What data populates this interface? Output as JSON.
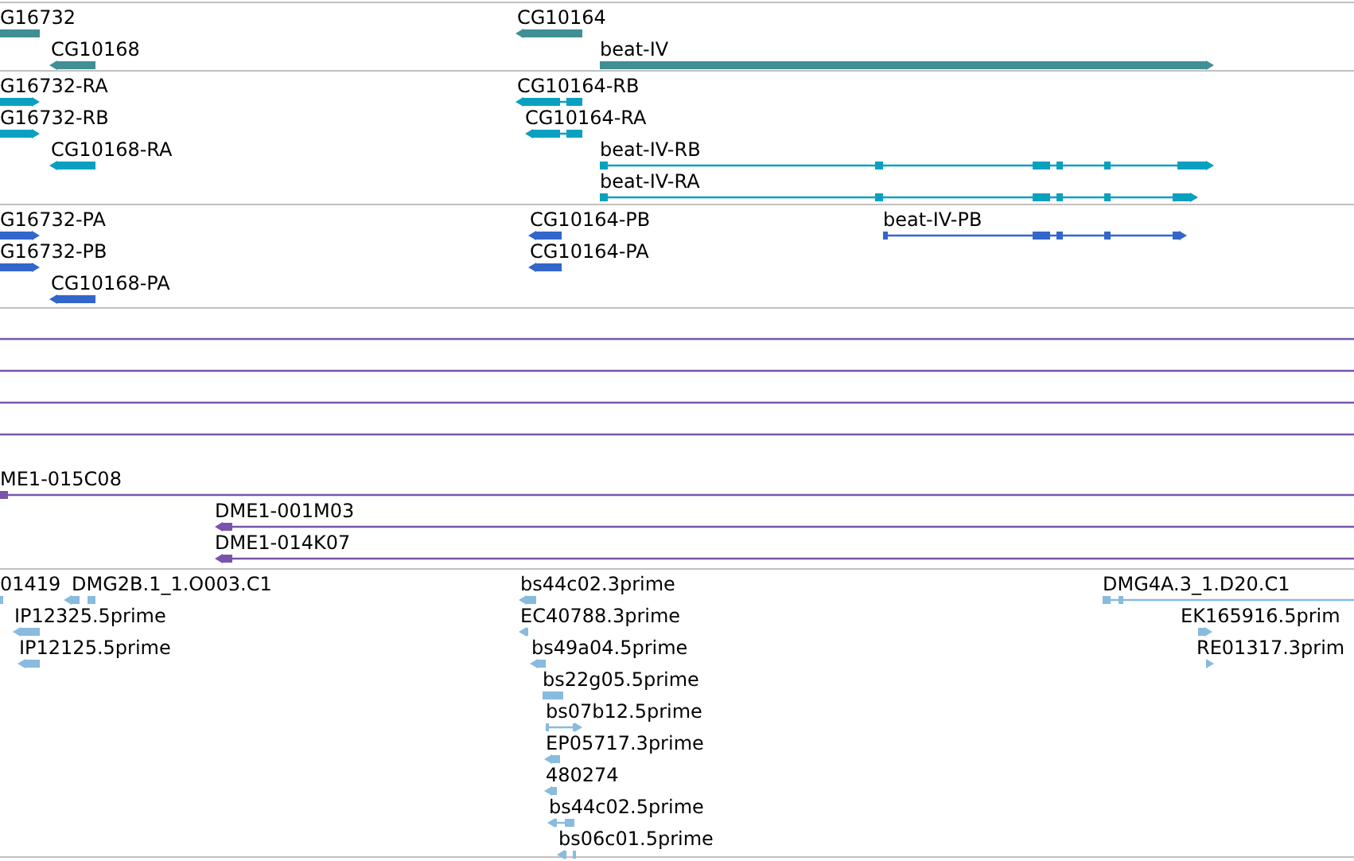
{
  "tracks": [
    {
      "color": "#3f8f94",
      "features": [
        {
          "label": "G16732",
          "kind": "block"
        },
        {
          "label": "CG10164",
          "kind": "block"
        },
        {
          "label": "CG10168",
          "kind": "block"
        },
        {
          "label": "beat-IV",
          "kind": "block"
        }
      ]
    },
    {
      "color": "#0aa0c0",
      "features": [
        {
          "label": "G16732-RA",
          "kind": "block"
        },
        {
          "label": "CG10164-RB",
          "kind": "spliced"
        },
        {
          "label": "G16732-RB",
          "kind": "block"
        },
        {
          "label": "CG10164-RA",
          "kind": "spliced"
        },
        {
          "label": "CG10168-RA",
          "kind": "block"
        },
        {
          "label": "beat-IV-RB",
          "kind": "spliced"
        },
        {
          "label": "beat-IV-RA",
          "kind": "spliced"
        }
      ]
    },
    {
      "color": "#3366cc",
      "features": [
        {
          "label": "G16732-PA",
          "kind": "block"
        },
        {
          "label": "CG10164-PB",
          "kind": "block"
        },
        {
          "label": "beat-IV-PB",
          "kind": "spliced"
        },
        {
          "label": "G16732-PB",
          "kind": "block"
        },
        {
          "label": "CG10164-PA",
          "kind": "block"
        },
        {
          "label": "CG10168-PA",
          "kind": "block"
        }
      ]
    },
    {
      "color": "#7755aa",
      "features": [
        {
          "kind": "span"
        },
        {
          "kind": "span"
        },
        {
          "kind": "span"
        },
        {
          "kind": "span"
        },
        {
          "label": "ME1-015C08",
          "kind": "span"
        },
        {
          "label": "DME1-001M03",
          "kind": "span"
        },
        {
          "label": "DME1-014K07",
          "kind": "span"
        }
      ]
    },
    {
      "color": "#88bbdd",
      "features": [
        {
          "label": "01419",
          "kind": "block"
        },
        {
          "label": "DMG2B.1_1.O003.C1",
          "kind": "block"
        },
        {
          "label": "bs44c02.3prime",
          "kind": "block"
        },
        {
          "label": "DMG4A.3_1.D20.C1",
          "kind": "span"
        },
        {
          "label": "IP12325.5prime",
          "kind": "block"
        },
        {
          "label": "EC40788.3prime",
          "kind": "block"
        },
        {
          "label": "EK165916.5prim",
          "kind": "block"
        },
        {
          "label": "IP12125.5prime",
          "kind": "block"
        },
        {
          "label": "bs49a04.5prime",
          "kind": "block"
        },
        {
          "label": "RE01317.3prim",
          "kind": "block"
        },
        {
          "label": "bs22g05.5prime",
          "kind": "block"
        },
        {
          "label": "bs07b12.5prime",
          "kind": "spliced"
        },
        {
          "label": "EP05717.3prime",
          "kind": "block"
        },
        {
          "label": "480274",
          "kind": "block"
        },
        {
          "label": "bs44c02.5prime",
          "kind": "spliced"
        },
        {
          "label": "bs06c01.5prime",
          "kind": "block"
        }
      ]
    }
  ]
}
